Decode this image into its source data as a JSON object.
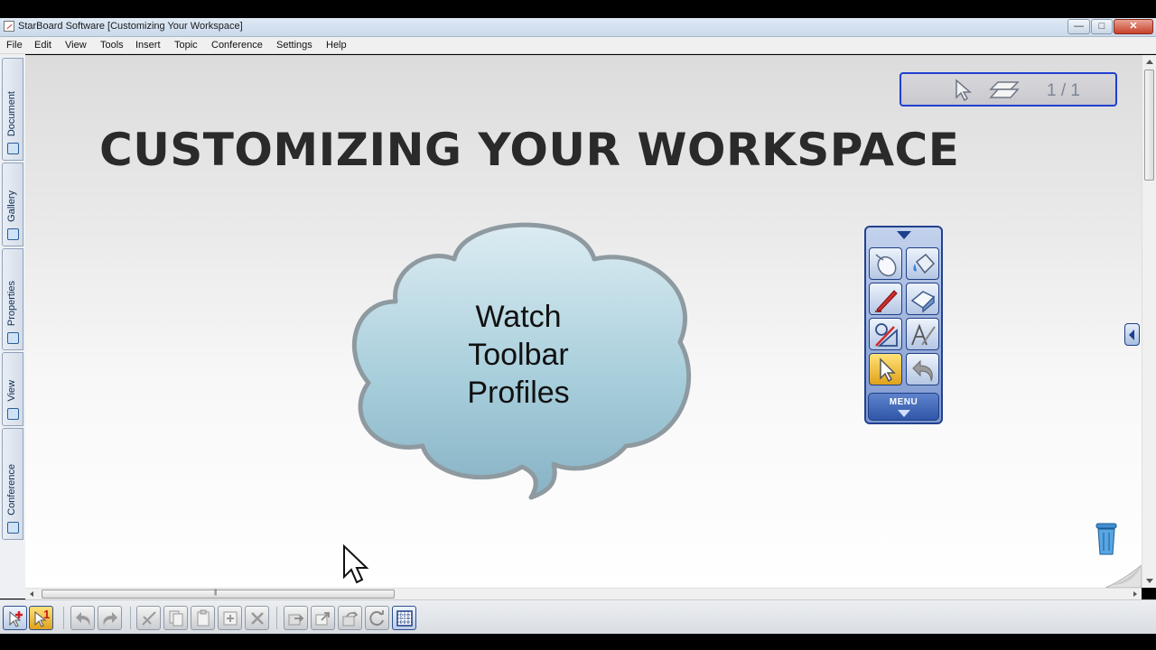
{
  "window": {
    "title": "StarBoard Software [Customizing Your Workspace]",
    "minimize_glyph": "—",
    "maximize_glyph": "□",
    "close_glyph": "✕"
  },
  "menu": [
    "File",
    "Edit",
    "View",
    "Tools",
    "Insert",
    "Topic",
    "Conference",
    "Settings",
    "Help"
  ],
  "side_tabs": [
    "Document",
    "Gallery",
    "Properties",
    "View",
    "Conference"
  ],
  "slide": {
    "title": "CUSTOMIZING YOUR WORKSPACE",
    "cloud_lines": [
      "Watch",
      "Toolbar",
      "Profiles"
    ]
  },
  "page_nav": {
    "counter": "1 / 1",
    "icons": [
      "pointer-icon",
      "page-stack-icon"
    ]
  },
  "floating_toolbar": {
    "buttons": [
      {
        "icon": "mouse-icon",
        "active": false
      },
      {
        "icon": "paint-bucket-icon",
        "active": false
      },
      {
        "icon": "pen-icon",
        "active": false
      },
      {
        "icon": "eraser-icon",
        "active": false
      },
      {
        "icon": "shapes-icon",
        "active": false
      },
      {
        "icon": "handwriting-recognition-icon",
        "active": false
      },
      {
        "icon": "select-arrow-icon",
        "active": true
      },
      {
        "icon": "undo-icon",
        "active": false
      }
    ],
    "menu_label": "MENU"
  },
  "bottom_toolbar": {
    "page_badge": "1",
    "buttons": [
      "add-page-icon",
      "page-select-icon",
      "undo-icon",
      "redo-icon",
      "cut-icon",
      "copy-icon",
      "paste-icon",
      "duplicate-icon",
      "delete-icon",
      "send-back-icon",
      "bring-front-icon",
      "flip-icon",
      "rotate-icon",
      "grid-icon"
    ]
  },
  "colors": {
    "accent_blue": "#1f3fcf",
    "toolbar_blue": "#22418f",
    "cloud_fill": "#a9cfdc",
    "active_tool": "#f2c233"
  }
}
